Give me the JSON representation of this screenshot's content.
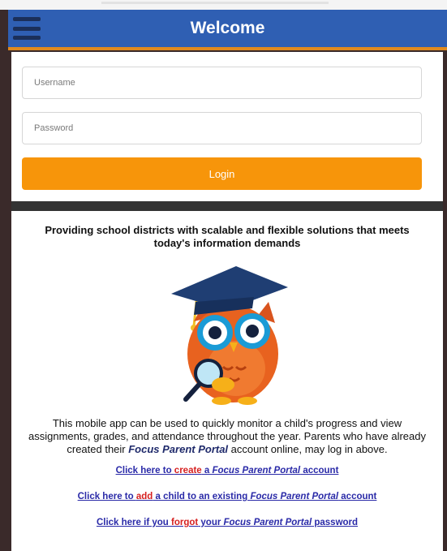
{
  "header": {
    "title": "Welcome"
  },
  "login": {
    "username_placeholder": "Username",
    "password_placeholder": "Password",
    "login_label": "Login"
  },
  "content": {
    "tagline": "Providing school districts with scalable and flexible solutions that meets today's information demands",
    "desc_part1": "This mobile app can be used to quickly monitor a child's progress and view assignments, grades, and attendance throughout the year. Parents who have already created their ",
    "desc_emph": "Focus Parent Portal",
    "desc_part2": " account online, may log in above."
  },
  "links": {
    "create": {
      "pre": "Click here to ",
      "keyword": "create",
      "mid": " a ",
      "product": "Focus Parent Portal",
      "post": " account"
    },
    "add": {
      "pre": "Click here to ",
      "keyword": "add",
      "mid": " a child to an existing ",
      "product": "Focus Parent Portal",
      "post": " account"
    },
    "forgot": {
      "pre": "Click here if you ",
      "keyword": "forgot",
      "mid": " your ",
      "product": "Focus Parent Portal",
      "post": " password"
    }
  },
  "colors": {
    "header_bg": "#2f5fb3",
    "login_button": "#f7950a",
    "link_text": "#2a2aa8",
    "link_keyword": "#d62020"
  },
  "icons": {
    "menu": "hamburger-menu-icon",
    "mascot": "owl-mascot-icon"
  }
}
